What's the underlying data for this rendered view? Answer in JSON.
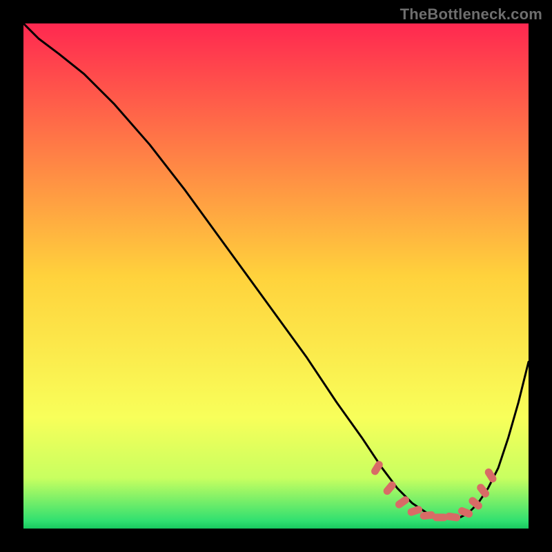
{
  "watermark": "TheBottleneck.com",
  "chart_data": {
    "type": "line",
    "title": "",
    "xlabel": "",
    "ylabel": "",
    "xlim": [
      0,
      100
    ],
    "ylim": [
      0,
      100
    ],
    "grid": false,
    "legend": false,
    "background_gradient": {
      "stops": [
        {
          "offset": 0.0,
          "color": "#ff2850"
        },
        {
          "offset": 0.5,
          "color": "#ffd23c"
        },
        {
          "offset": 0.78,
          "color": "#f8ff5a"
        },
        {
          "offset": 0.9,
          "color": "#c8ff60"
        },
        {
          "offset": 0.985,
          "color": "#30e070"
        },
        {
          "offset": 1.0,
          "color": "#18c860"
        }
      ]
    },
    "series": [
      {
        "name": "main-curve",
        "color": "#000000",
        "x": [
          0,
          3,
          7,
          12,
          18,
          25,
          32,
          40,
          48,
          56,
          62,
          67,
          71,
          74,
          77,
          80,
          83,
          86,
          88,
          90,
          92,
          94,
          96,
          98,
          100
        ],
        "y": [
          100,
          97,
          94,
          90,
          84,
          76,
          67,
          56,
          45,
          34,
          25,
          18,
          12,
          8,
          5,
          3,
          2,
          2,
          3,
          5,
          8,
          12,
          18,
          25,
          33
        ]
      }
    ],
    "markers": {
      "name": "bottom-band",
      "color": "#d86b66",
      "shape": "rounded-dash",
      "points": [
        {
          "x": 70.0,
          "y": 12.0,
          "angle": -58
        },
        {
          "x": 72.5,
          "y": 8.0,
          "angle": -50
        },
        {
          "x": 75.0,
          "y": 5.2,
          "angle": -35
        },
        {
          "x": 77.5,
          "y": 3.5,
          "angle": -18
        },
        {
          "x": 80.0,
          "y": 2.6,
          "angle": -6
        },
        {
          "x": 82.5,
          "y": 2.2,
          "angle": 0
        },
        {
          "x": 85.0,
          "y": 2.3,
          "angle": 8
        },
        {
          "x": 87.5,
          "y": 3.2,
          "angle": 22
        },
        {
          "x": 89.5,
          "y": 5.0,
          "angle": 40
        },
        {
          "x": 91.0,
          "y": 7.5,
          "angle": 52
        },
        {
          "x": 92.5,
          "y": 10.5,
          "angle": 58
        }
      ]
    }
  }
}
